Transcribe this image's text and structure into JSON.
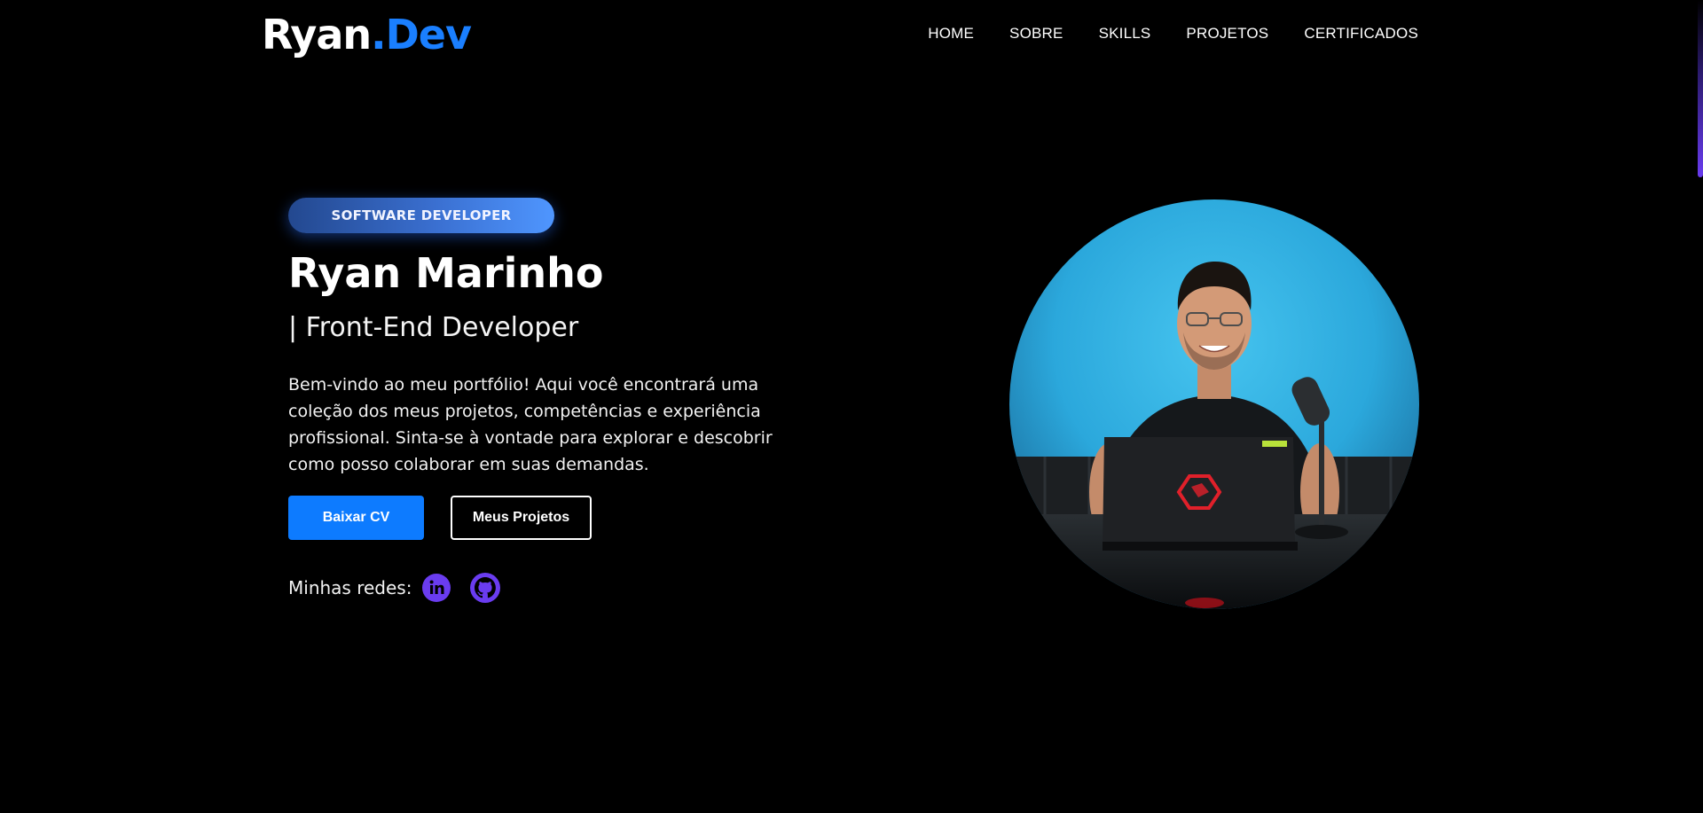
{
  "header": {
    "logo_name": "Ryan",
    "logo_suffix": ".Dev",
    "nav": [
      "HOME",
      "SOBRE",
      "SKILLS",
      "PROJETOS",
      "CERTIFICADOS"
    ]
  },
  "hero": {
    "badge": "SOFTWARE DEVELOPER",
    "name": "Ryan Marinho",
    "role": "| Front-End Developer",
    "intro": "Bem-vindo ao meu portfólio! Aqui você encontrará uma coleção dos meus projetos, competências e experiência profissional. Sinta-se à vontade para explorar e descobrir como posso colaborar em suas demandas.",
    "primary_button": "Baixar CV",
    "secondary_button": "Meus Projetos",
    "socials_label": "Minhas redes:",
    "socials": [
      {
        "icon": "linkedin-icon"
      },
      {
        "icon": "github-icon"
      }
    ]
  },
  "colors": {
    "accent": "#0d7bff",
    "logo_accent": "#1a7fff",
    "social": "#6a3cf0",
    "background": "#000000"
  }
}
